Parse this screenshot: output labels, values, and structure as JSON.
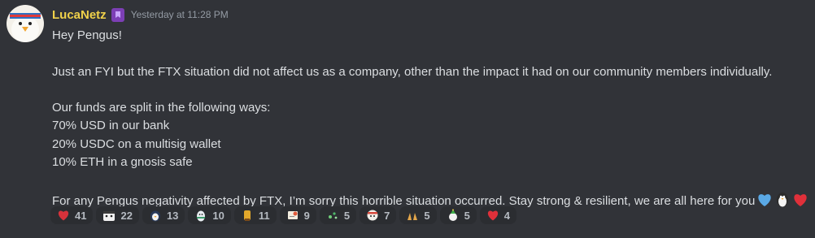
{
  "author": {
    "name": "LucaNetz",
    "timestamp": "Yesterday at 11:28 PM",
    "avatar_icon": "penguin-headband-icon",
    "badge_icon": "role-badge-icon",
    "name_color": "#f0d14a"
  },
  "message": {
    "lines": [
      "Hey Pengus!",
      "",
      "Just an FYI but the FTX situation did not affect us as a company, other than the impact it had on our community members individually.",
      "",
      "Our funds are split in the following ways:",
      "70% USD in our bank",
      "20% USDC on a multisig wallet",
      "10% ETH in a gnosis safe",
      "",
      "For any Pengus negativity affected by FTX, I’m sorry this horrible situation occurred. Stay strong & resilient, we are all here for you"
    ],
    "trailing_emojis": [
      "blue-heart-icon",
      "penguin-icon",
      "red-heart-icon"
    ]
  },
  "reactions": [
    {
      "icon": "red-heart-icon",
      "count": "41"
    },
    {
      "icon": "penguin-blanket-icon",
      "count": "22"
    },
    {
      "icon": "penguin-face-icon",
      "count": "13"
    },
    {
      "icon": "penguin-scarf-icon",
      "count": "10"
    },
    {
      "icon": "penguin-gold-icon",
      "count": "11"
    },
    {
      "icon": "penguin-paper-icon",
      "count": "9"
    },
    {
      "icon": "penguin-sparkle-icon",
      "count": "5"
    },
    {
      "icon": "penguin-round-icon",
      "count": "7"
    },
    {
      "icon": "raised-hands-icon",
      "count": "5"
    },
    {
      "icon": "penguin-party-icon",
      "count": "5"
    },
    {
      "icon": "red-heart-icon",
      "count": "4"
    }
  ]
}
